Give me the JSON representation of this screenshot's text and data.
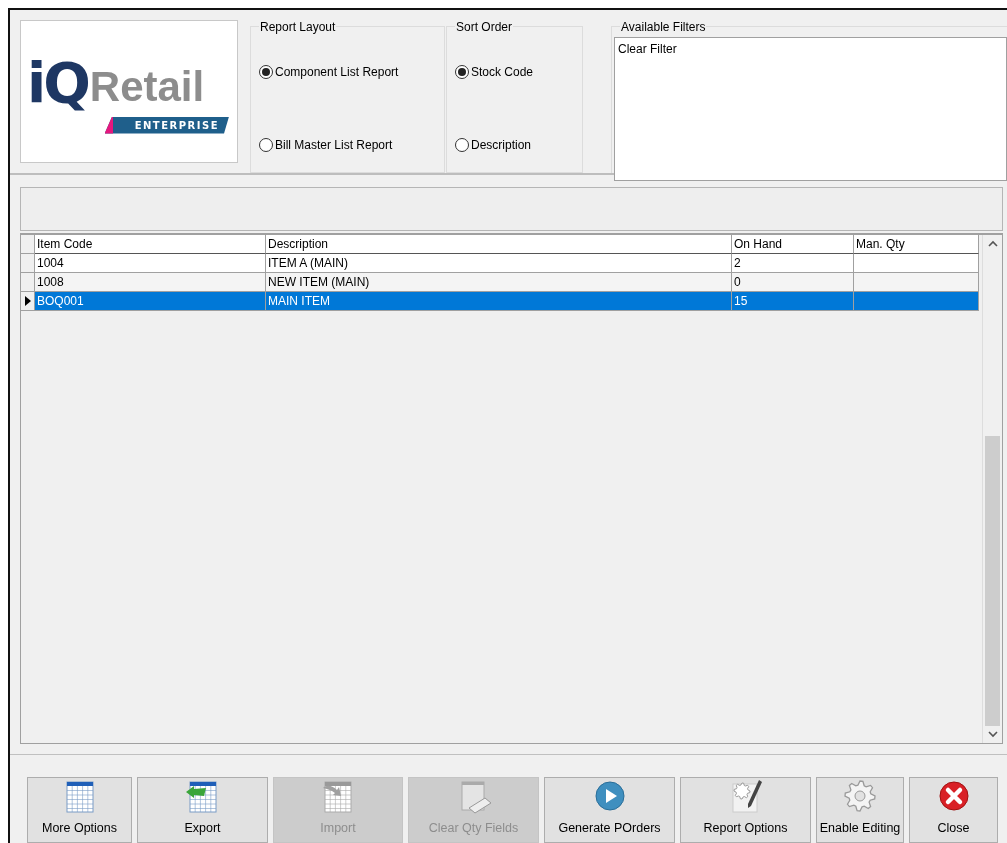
{
  "logo": {
    "mark": "iQ",
    "wordmark": "Retail",
    "tagline": "ENTERPRISE"
  },
  "report_layout": {
    "title": "Report Layout",
    "options": [
      {
        "label": "Component List Report",
        "selected": true
      },
      {
        "label": "Bill Master List Report",
        "selected": false
      }
    ]
  },
  "sort_order": {
    "title": "Sort Order",
    "options": [
      {
        "label": "Stock Code",
        "selected": true
      },
      {
        "label": "Description",
        "selected": false
      }
    ]
  },
  "available_filters": {
    "title": "Available Filters",
    "items": [
      "Clear Filter"
    ]
  },
  "table": {
    "columns": [
      "Item Code",
      "Description",
      "On Hand",
      "Man. Qty"
    ],
    "rows": [
      {
        "cells": [
          "1004",
          "ITEM A (MAIN)",
          "2",
          ""
        ],
        "selected": false
      },
      {
        "cells": [
          "1008",
          "NEW ITEM (MAIN)",
          "0",
          ""
        ],
        "selected": false
      },
      {
        "cells": [
          "BOQ001",
          "MAIN ITEM",
          "15",
          ""
        ],
        "selected": true
      }
    ]
  },
  "buttons": [
    {
      "label": "More Options",
      "disabled": false
    },
    {
      "label": "Export",
      "disabled": false
    },
    {
      "label": "Import",
      "disabled": true
    },
    {
      "label": "Clear Qty Fields",
      "disabled": true
    },
    {
      "label": "Generate POrders",
      "disabled": false
    },
    {
      "label": "Report Options",
      "disabled": false
    },
    {
      "label": "Enable Editing",
      "disabled": false
    },
    {
      "label": "Close",
      "disabled": false
    }
  ]
}
